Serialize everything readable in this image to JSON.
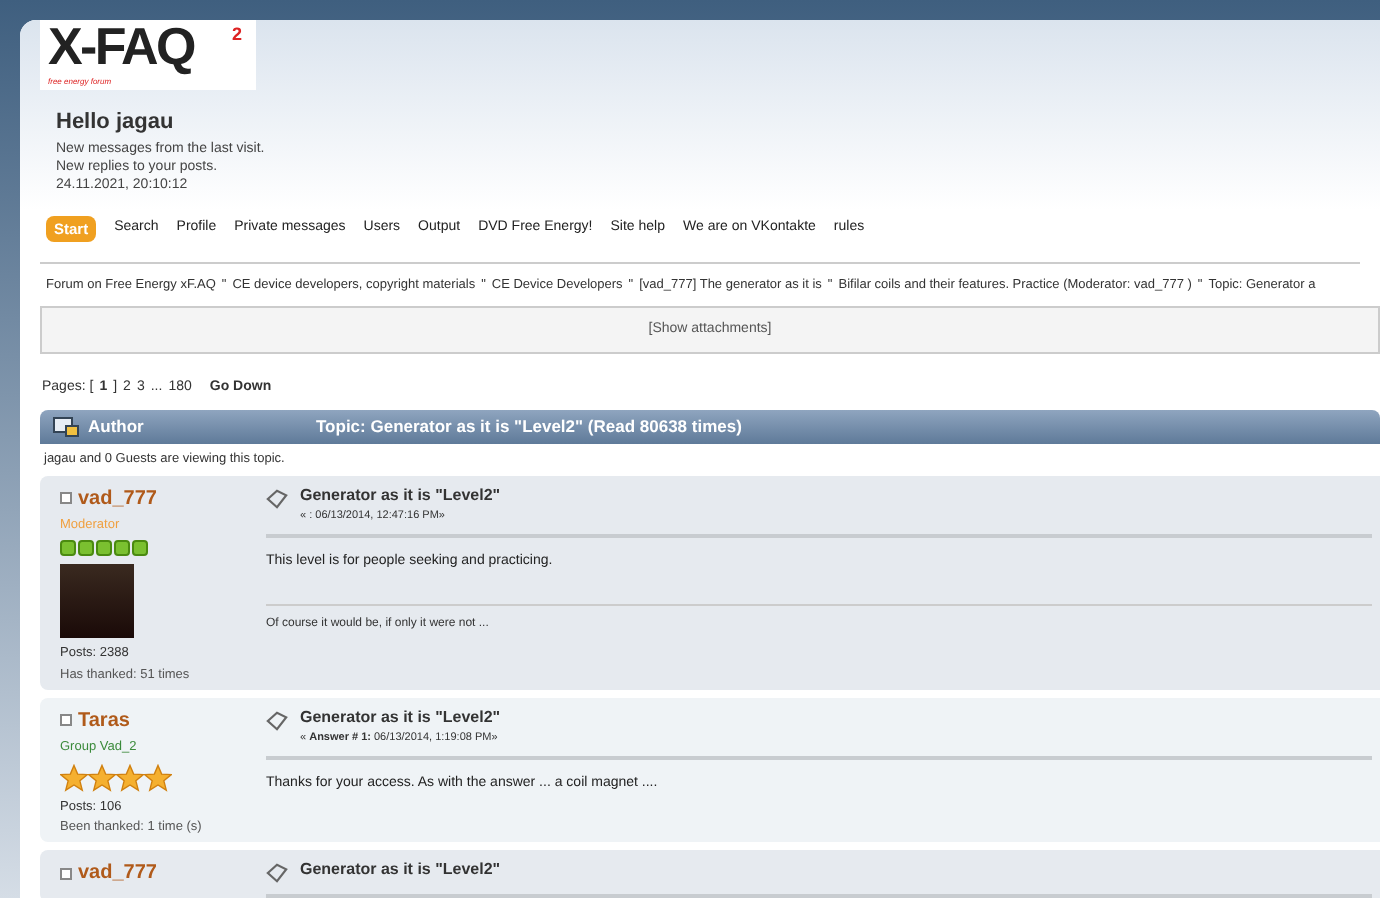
{
  "logo": {
    "text": "X-FAQ",
    "superscript": "2",
    "tagline": "free energy forum"
  },
  "greeting": {
    "title": "Hello jagau",
    "lines": [
      "New messages from the last visit.",
      "New replies to your posts.",
      "24.11.2021, 20:10:12"
    ]
  },
  "nav": [
    {
      "label": "Start",
      "selected": true
    },
    {
      "label": "Search",
      "selected": false
    },
    {
      "label": "Profile",
      "selected": false
    },
    {
      "label": "Private messages",
      "selected": false
    },
    {
      "label": "Users",
      "selected": false
    },
    {
      "label": "Output",
      "selected": false
    },
    {
      "label": "DVD Free Energy!",
      "selected": false
    },
    {
      "label": "Site help",
      "selected": false
    },
    {
      "label": "We are on VKontakte",
      "selected": false
    },
    {
      "label": "rules",
      "selected": false
    }
  ],
  "breadcrumb": {
    "separator": "\"",
    "items": [
      "Forum on Free Energy xF.AQ",
      "CE device developers, copyright materials",
      "CE Device Developers",
      "[vad_777] The generator as it is",
      "Bifilar coils and their features. Practice (Moderator: vad_777 )",
      "Topic: Generator a"
    ]
  },
  "attachments_button": "[Show attachments]",
  "pages": {
    "label": "Pages: [",
    "current": "1",
    "after": "]",
    "links": [
      "2",
      "3",
      "...",
      "180"
    ],
    "go_down": "Go Down"
  },
  "header": {
    "author": "Author",
    "topic": "Topic: Generator as it is \"Level2\" (Read 80638 times)"
  },
  "viewing": "jagau and 0 Guests are viewing this topic.",
  "posts": [
    {
      "alternate": false,
      "author": "vad_777",
      "role": "Moderator",
      "color": "#f0a040",
      "rank": {
        "kind": "pips",
        "stars": 5
      },
      "avatar": true,
      "posts": "Posts: 2388",
      "thanks": "Has thanked: 51 times",
      "title": "Generator as it is \"Level2\"",
      "meta": "« : 06/13/2014, 12:47:16 PM»",
      "body": "This level is for people seeking and practicing.",
      "signature": "Of course it would be, if only it were not ..."
    },
    {
      "alternate": true,
      "author": "Taras",
      "role": "Group Vad_2",
      "color": "#3a8a3a",
      "rank": {
        "kind": "stars",
        "stars": 4
      },
      "avatar": false,
      "posts": "Posts: 106",
      "thanks": "Been thanked: 1 time (s)",
      "title": "Generator as it is \"Level2\"",
      "meta": "« **Answer # 1:** 06/13/2014, 1:19:08 PM»",
      "body": "Thanks for your access. As with the answer ... a coil magnet ...."
    },
    {
      "alternate": false,
      "author": "vad_777",
      "title": "Generator as it is \"Level2\""
    }
  ]
}
